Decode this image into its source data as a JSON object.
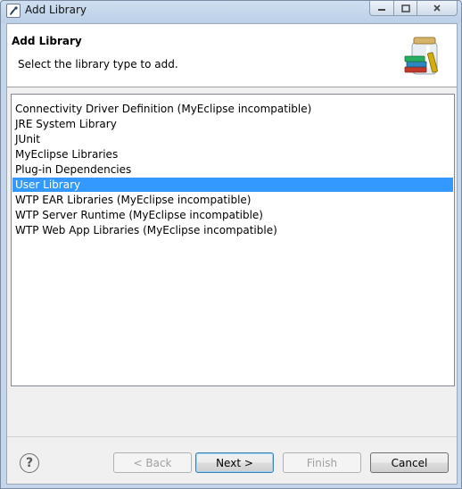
{
  "window": {
    "title": "Add Library"
  },
  "header": {
    "title": "Add Library",
    "message": "Select the library type to add.",
    "icon": "library-jar-icon"
  },
  "library_types": [
    {
      "label": "Connectivity Driver Definition (MyEclipse incompatible)",
      "selected": false
    },
    {
      "label": "JRE System Library",
      "selected": false
    },
    {
      "label": "JUnit",
      "selected": false
    },
    {
      "label": "MyEclipse Libraries",
      "selected": false
    },
    {
      "label": "Plug-in Dependencies",
      "selected": false
    },
    {
      "label": "User Library",
      "selected": true
    },
    {
      "label": "WTP EAR Libraries (MyEclipse incompatible)",
      "selected": false
    },
    {
      "label": "WTP Server Runtime (MyEclipse incompatible)",
      "selected": false
    },
    {
      "label": "WTP Web App Libraries (MyEclipse incompatible)",
      "selected": false
    }
  ],
  "buttons": {
    "help": "?",
    "back": "< Back",
    "next": "Next >",
    "finish": "Finish",
    "cancel": "Cancel"
  },
  "colors": {
    "selection": "#3399ff",
    "default_button_border": "#3c7fb1"
  }
}
